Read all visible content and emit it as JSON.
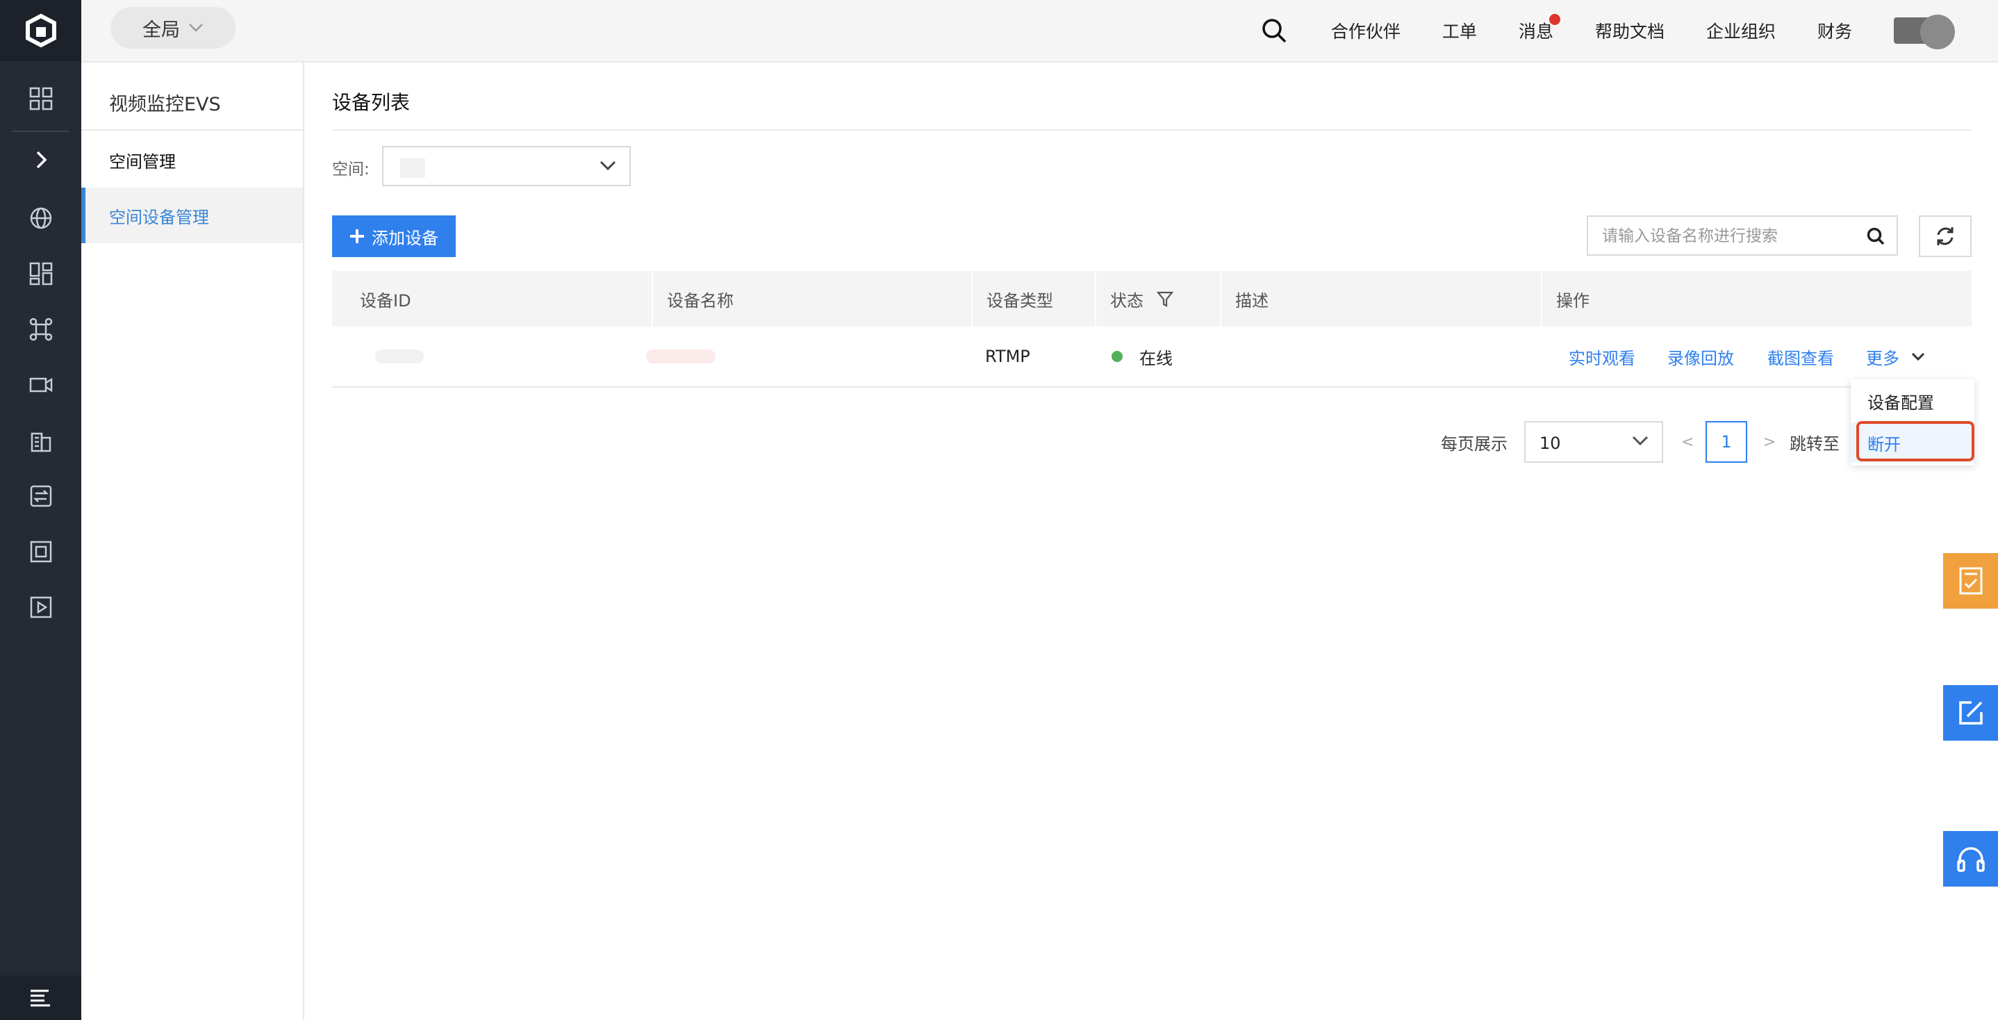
{
  "header": {
    "scope_label": "全局",
    "nav": [
      "合作伙伴",
      "工单",
      "消息",
      "帮助文档",
      "企业组织",
      "财务"
    ]
  },
  "sidebar": {
    "title": "视频监控EVS",
    "items": [
      {
        "label": "空间管理",
        "active": false
      },
      {
        "label": "空间设备管理",
        "active": true
      }
    ]
  },
  "main": {
    "title": "设备列表",
    "space_label": "空间:",
    "add_button": "添加设备",
    "search_placeholder": "请输入设备名称进行搜索",
    "columns": [
      "设备ID",
      "设备名称",
      "设备类型",
      "状态",
      "描述",
      "操作"
    ],
    "rows": [
      {
        "device_type": "RTMP",
        "status": "在线",
        "actions": [
          "实时观看",
          "录像回放",
          "截图查看",
          "更多"
        ]
      }
    ],
    "pagination": {
      "page_size_label": "每页展示",
      "page_size": "10",
      "prev": "<",
      "current_page": "1",
      "next": ">",
      "jump_label": "跳转至"
    },
    "more_menu": [
      "设备配置",
      "断开"
    ]
  },
  "colors": {
    "accent": "#2f80ed",
    "rail": "#252a34",
    "online": "#52b05a",
    "highlight": "#e04a2a",
    "float_orange": "#f0a03c",
    "float_blue": "#2f80ed"
  }
}
